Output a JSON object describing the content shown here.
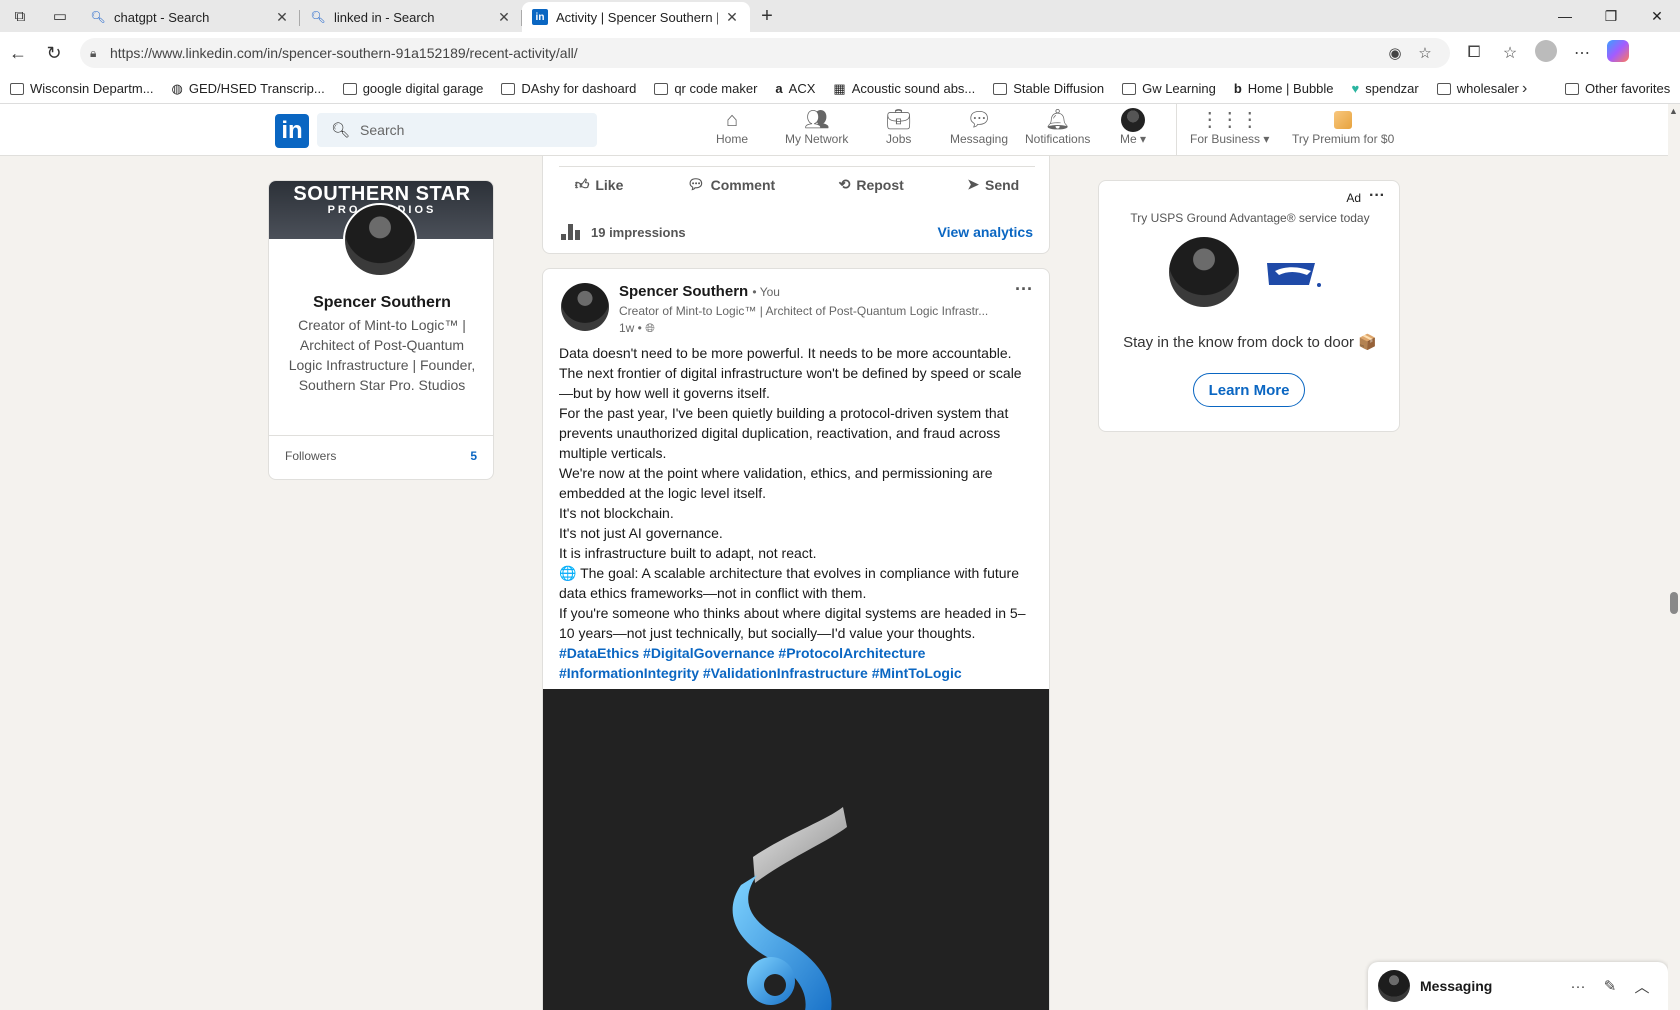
{
  "browser": {
    "tabs": [
      {
        "title": "chatgpt - Search",
        "icon": "search-icon"
      },
      {
        "title": "linked in - Search",
        "icon": "search-icon"
      },
      {
        "title": "Activity | Spencer Southern | Linke",
        "icon": "linkedin-icon"
      }
    ],
    "url": "https://www.linkedin.com/in/spencer-southern-91a152189/recent-activity/all/",
    "bookmarks": [
      "Wisconsin Departm...",
      "GED/HSED Transcrip...",
      "google digital garage",
      "DAshy for dashoard",
      "qr code maker",
      "ACX",
      "Acoustic sound abs...",
      "Stable Diffusion",
      "Gw Learning",
      "Home | Bubble",
      "spendzar",
      "wholesaler"
    ],
    "other_favorites": "Other favorites"
  },
  "linkedin": {
    "logo": "in",
    "search_placeholder": "Search",
    "nav": {
      "home": "Home",
      "network": "My Network",
      "jobs": "Jobs",
      "messaging": "Messaging",
      "notifications": "Notifications",
      "me": "Me",
      "business": "For Business",
      "premium": "Try Premium for $0"
    }
  },
  "profile": {
    "banner_title": "SOUTHERN STAR",
    "banner_sub": "PRO STUDIOS",
    "name": "Spencer Southern",
    "headline": "Creator of Mint-to Logic™ | Architect of Post-Quantum Logic Infrastructure | Founder, Southern Star Pro. Studios",
    "followers_label": "Followers",
    "followers_count": "5"
  },
  "prev_post": {
    "like": "Like",
    "comment": "Comment",
    "repost": "Repost",
    "send": "Send",
    "impressions": "19 impressions",
    "view_analytics": "View analytics"
  },
  "post": {
    "author": "Spencer Southern",
    "you_badge": "• You",
    "headline": "Creator of Mint-to Logic™ | Architect of Post-Quantum Logic Infrastr...",
    "time": "1w •",
    "lines": [
      "Data doesn't need to be more powerful. It needs to be more accountable.",
      " The next frontier of digital infrastructure won't be defined by speed or scale",
      "—but by how well it governs itself.",
      "For the past year, I've been quietly building a protocol-driven system that",
      "prevents unauthorized digital duplication, reactivation, and fraud across",
      "multiple verticals.",
      " We're now at the point where validation, ethics, and permissioning are",
      "embedded at the logic level itself.",
      "It's not blockchain.",
      " It's not just AI governance.",
      " It is infrastructure built to adapt, not react.",
      "🌐 The goal: A scalable architecture that evolves in compliance with future",
      "data ethics frameworks—not in conflict with them.",
      "If you're someone who thinks about where digital systems are headed in 5–",
      "10 years—not just technically, but socially—I'd value your thoughts."
    ],
    "tags_line1": "#DataEthics #DigitalGovernance #ProtocolArchitecture",
    "tags_line2": "#InformationIntegrity #ValidationInfrastructure #MintToLogic"
  },
  "ad": {
    "label": "Ad",
    "title": "Try USPS Ground Advantage® service today",
    "text": "Stay in the know from dock to door 📦",
    "button": "Learn More"
  },
  "messaging": {
    "label": "Messaging"
  }
}
